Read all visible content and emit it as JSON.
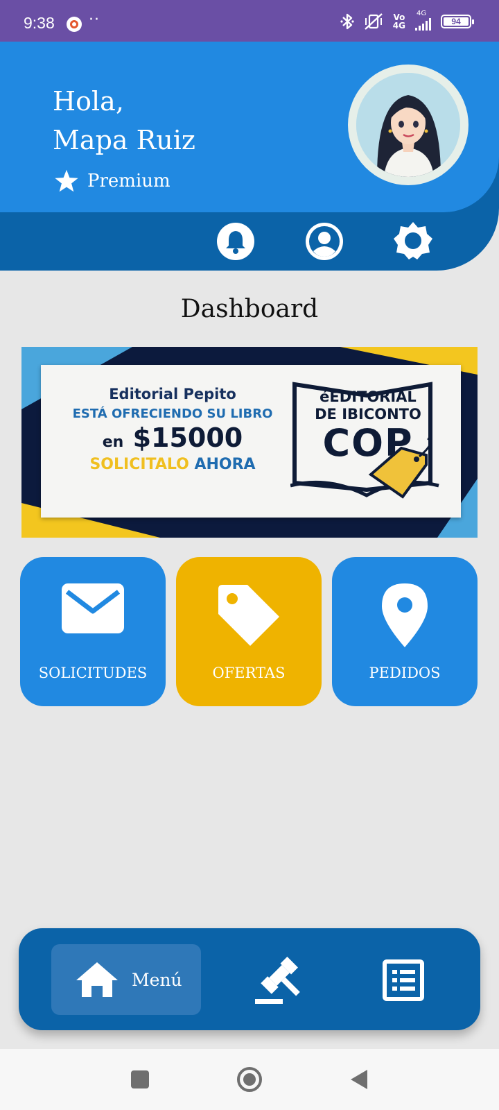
{
  "status_bar": {
    "time": "9:38",
    "dots": "··",
    "network": "Vo 4G",
    "network_top": "Vo",
    "network_bottom": "4G",
    "signal_label": "4G",
    "battery": "94"
  },
  "header": {
    "greeting_line1": "Hola,",
    "greeting_line2": "Mapa Ruiz",
    "tier": "Premium",
    "icons": [
      "bell-icon",
      "user-icon",
      "settings-icon"
    ],
    "colors": {
      "primary": "#2189e1",
      "dark": "#0b63a8",
      "accent": "#f0b400"
    }
  },
  "dashboard": {
    "title": "Dashboard"
  },
  "banner": {
    "line1": "Editorial Pepito",
    "line2": "ESTÁ OFRECIENDO SU LIBRO",
    "line3_prefix": "en",
    "line3_amount": "$15000",
    "line4_a": "SOLICITALO",
    "line4_b": "AHORA",
    "logo_line1": "éEDITORIÁL",
    "logo_line2": "DE IBICONTO",
    "logo_line3": "COP"
  },
  "tiles": [
    {
      "label": "SOLICITUDES",
      "icon": "envelope-icon",
      "color": "#2189e1"
    },
    {
      "label": "OFERTAS",
      "icon": "tag-icon",
      "color": "#efb300"
    },
    {
      "label": "PEDIDOS",
      "icon": "location-pin-icon",
      "color": "#2189e1"
    }
  ],
  "bottom_nav": {
    "menu_label": "Menú",
    "items": [
      "home-icon",
      "gavel-icon",
      "list-icon"
    ]
  },
  "system_nav": [
    "recent-apps-icon",
    "home-circle-icon",
    "back-icon"
  ]
}
